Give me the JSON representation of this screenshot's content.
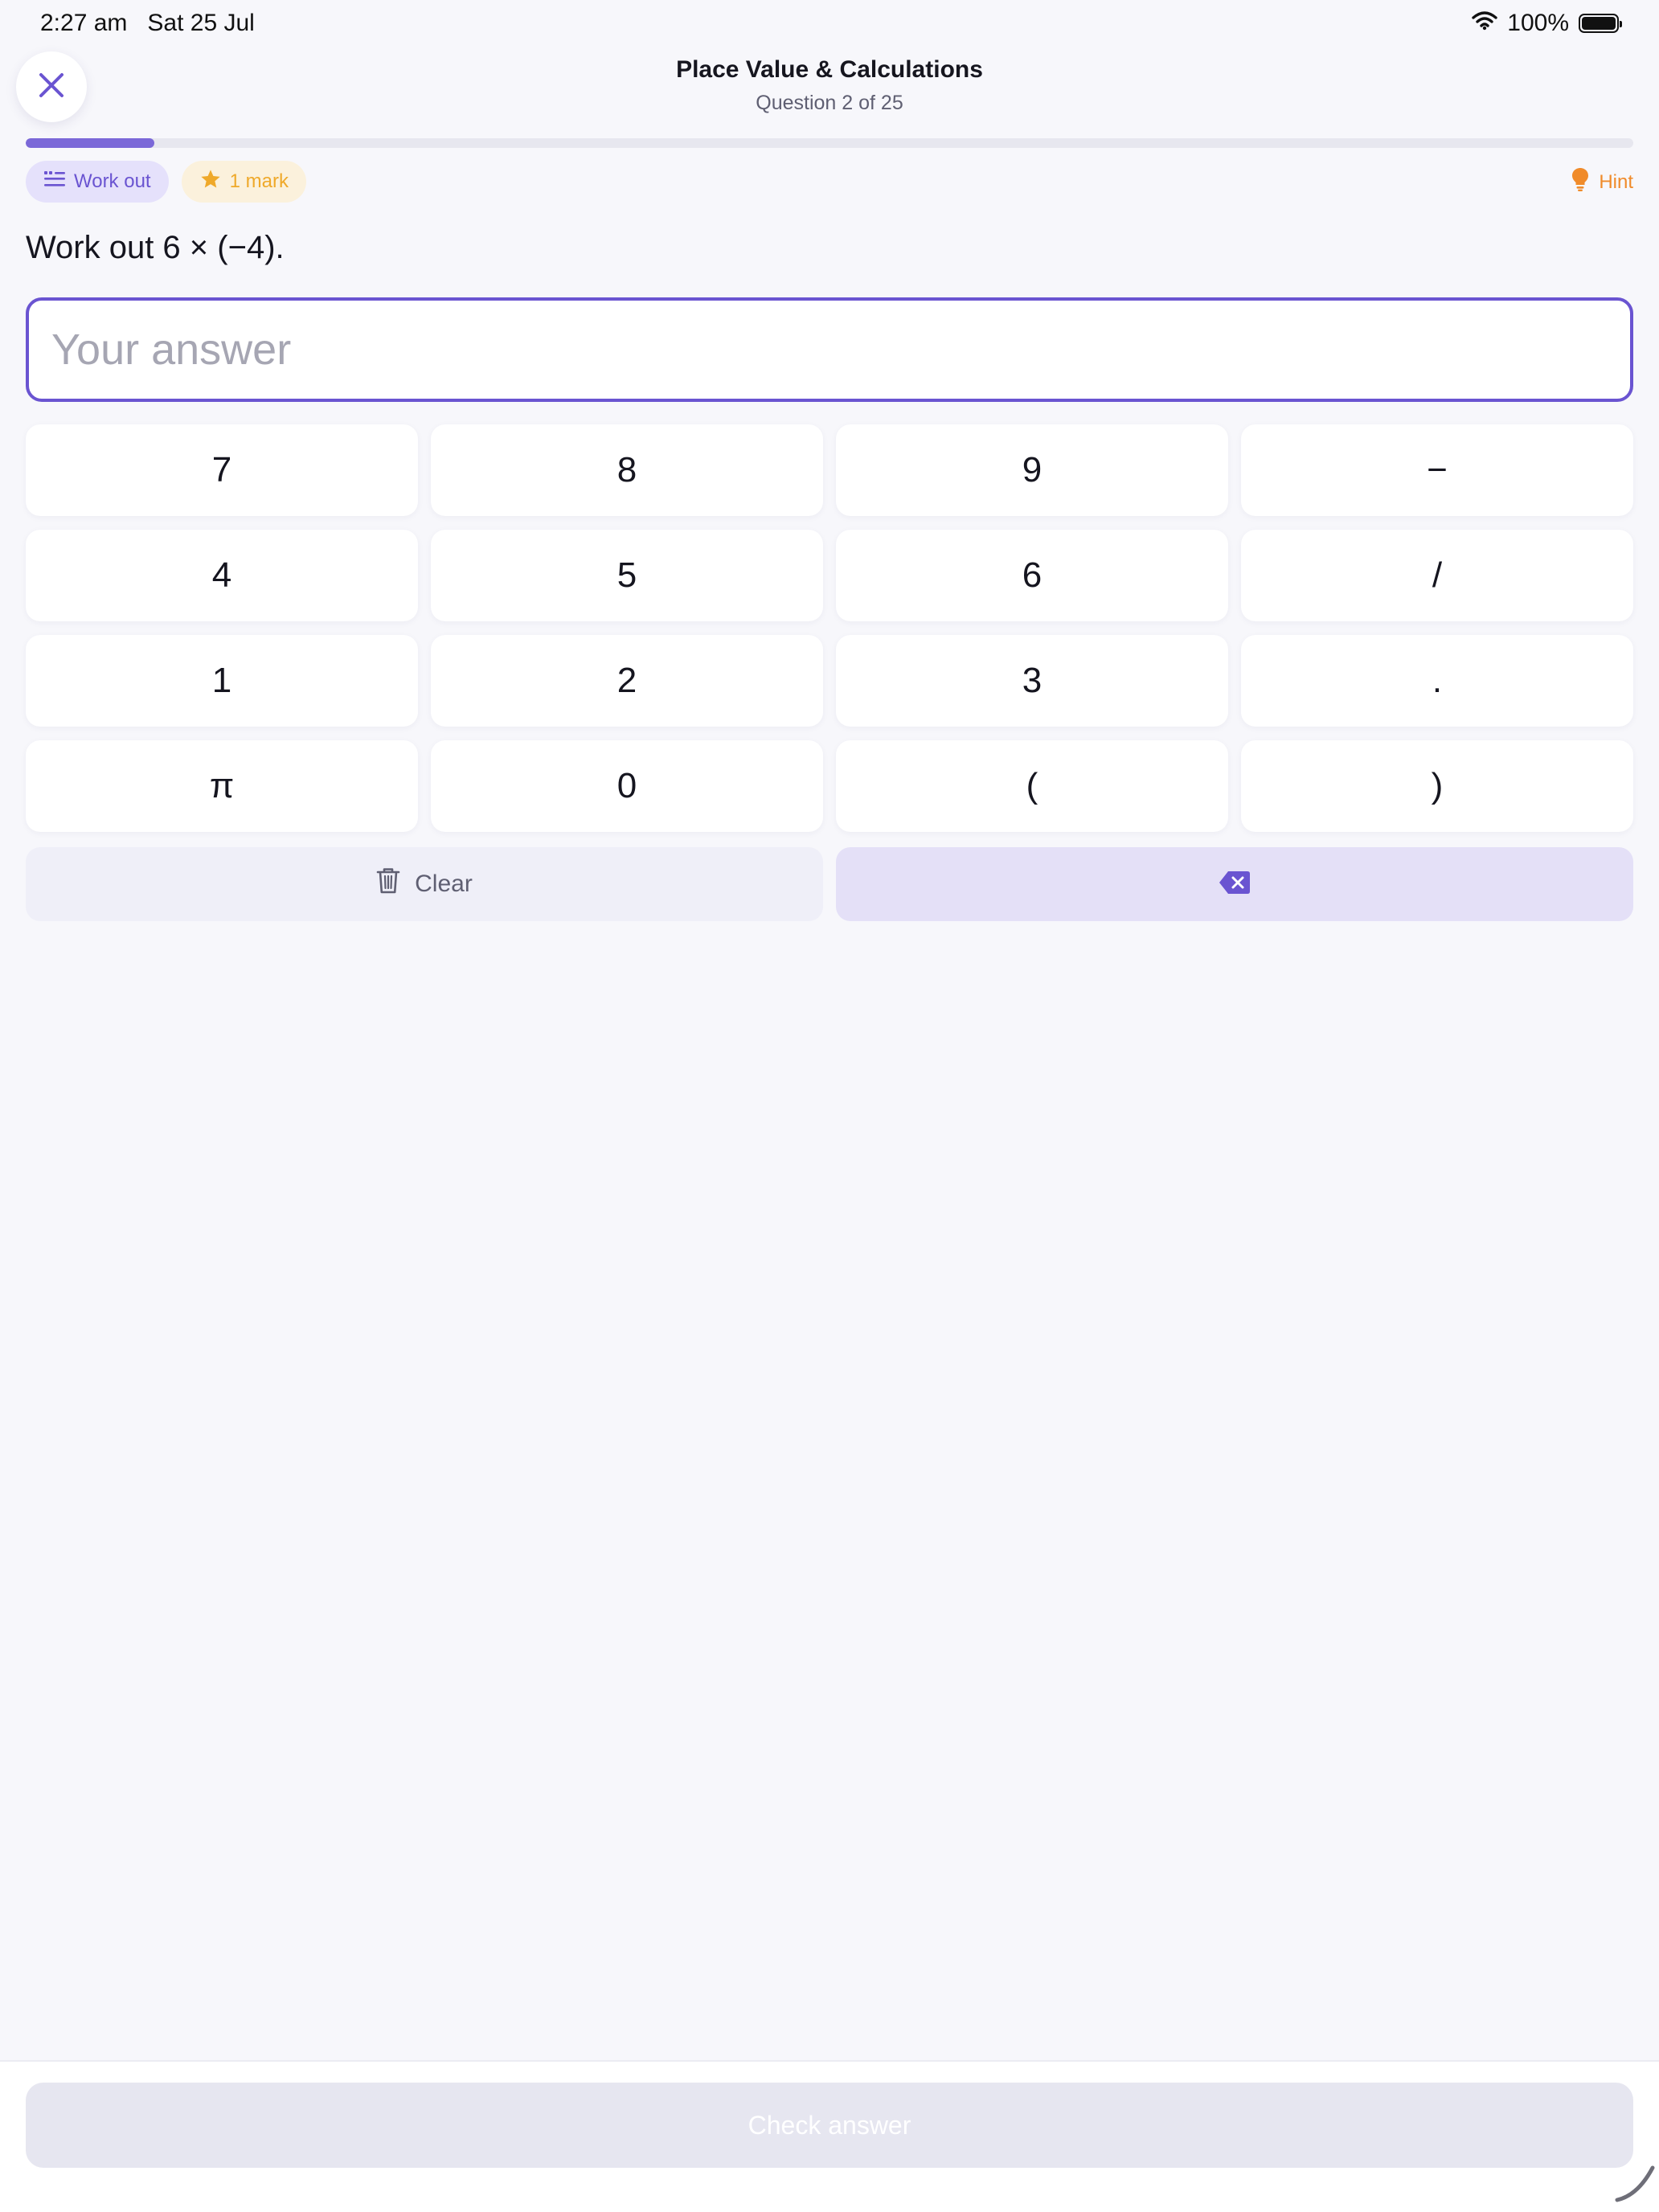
{
  "status_bar": {
    "time": "2:27 am",
    "date": "Sat 25 Jul",
    "battery": "100%",
    "icons": [
      "wifi-icon",
      "battery-icon"
    ]
  },
  "header": {
    "close_icon": "close-icon",
    "title": "Place Value & Calculations",
    "subtitle": "Question 2 of 25",
    "progress": {
      "current": 2,
      "total": 25
    }
  },
  "chips": {
    "type_label": "Work out",
    "type_icon": "list-icon",
    "marks_label": "1 mark",
    "marks_icon": "star-icon"
  },
  "hint": {
    "label": "Hint",
    "icon": "lightbulb-icon"
  },
  "question": {
    "text": "Work out 6 × (−4)."
  },
  "answer": {
    "value": "",
    "placeholder": "Your answer"
  },
  "keypad": {
    "keys": [
      "7",
      "8",
      "9",
      "−",
      "4",
      "5",
      "6",
      "/",
      "1",
      "2",
      "3",
      ".",
      "π",
      "0",
      "(",
      ")"
    ]
  },
  "actions": {
    "clear_label": "Clear",
    "clear_icon": "trash-icon",
    "backspace_icon": "backspace-icon"
  },
  "footer": {
    "check_label": "Check answer"
  },
  "colors": {
    "accent": "#6a54d1",
    "progress_fill": "#7b68d8",
    "marks": "#efa92a",
    "hint": "#f08b2a",
    "background": "#f7f7fb",
    "disabled_button": "#e6e6f0"
  }
}
